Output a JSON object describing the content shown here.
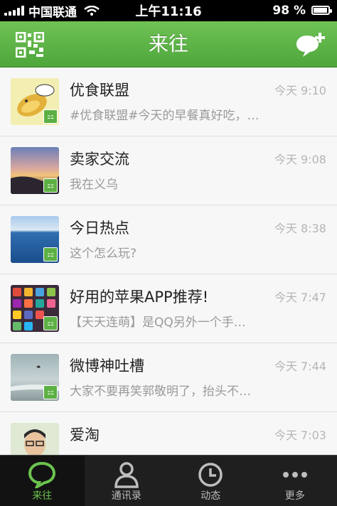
{
  "status": {
    "carrier": "中国联通",
    "time": "上午11:16",
    "battery": "98 %"
  },
  "header": {
    "title": "来往",
    "left_icon": "qr-code-icon",
    "right_icon": "add-contact-icon"
  },
  "conversations": [
    {
      "name": "优食联盟",
      "time": "今天 9:10",
      "message": "#优食联盟#今天的早餐真好吃，…"
    },
    {
      "name": "卖家交流",
      "time": "今天 9:08",
      "message": "我在义乌"
    },
    {
      "name": "今日热点",
      "time": "今天 8:38",
      "message": "这个怎么玩?"
    },
    {
      "name": "好用的苹果APP推荐!",
      "time": "今天 7:47",
      "message": "【天天连萌】是QQ另外一个手…"
    },
    {
      "name": "微博神吐槽",
      "time": "今天 7:44",
      "message": "大家不要再笑郭敬明了，抬头不…"
    },
    {
      "name": "爱淘",
      "time": "今天 7:03",
      "message": ""
    }
  ],
  "tabs": [
    {
      "label": "来往",
      "icon": "chat-bubble-icon"
    },
    {
      "label": "通讯录",
      "icon": "contacts-icon"
    },
    {
      "label": "动态",
      "icon": "clock-icon"
    },
    {
      "label": "更多",
      "icon": "more-icon"
    }
  ],
  "colors": {
    "accent": "#5cb043",
    "header": "#5fb448",
    "tabbar": "#1f1f1f"
  }
}
